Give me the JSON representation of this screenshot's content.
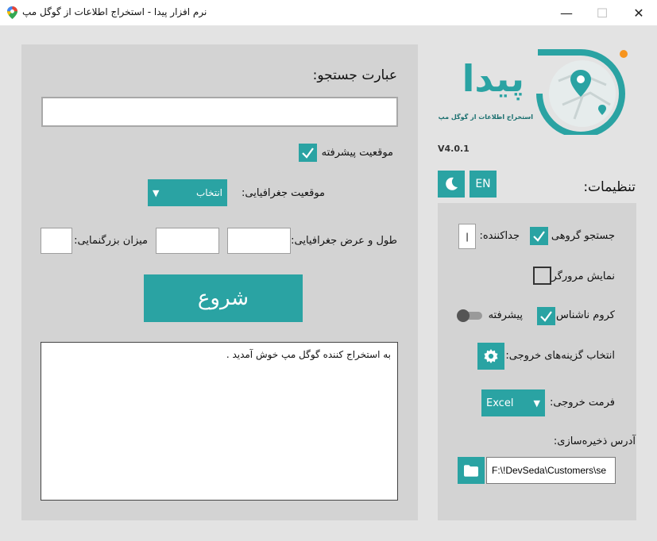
{
  "window": {
    "title": "نرم افزار پیدا - استخراج اطلاعات از گوگل مپ",
    "minimize_glyph": "—",
    "maximize_glyph": "☐",
    "close_glyph": "✕"
  },
  "search": {
    "label": "عبارت جستجو:",
    "value": "",
    "advanced_location_label": "موقعیت پیشرفته",
    "advanced_location_checked": true,
    "geo_location_label": "موقعیت جغرافیایی:",
    "geo_location_selected": "انتخاب",
    "latlng_label": "طول و عرض جغرافیایی:",
    "lat_value": "",
    "lng_value": "",
    "zoom_label": "میزان بزرگنمایی:",
    "zoom_value": "",
    "start_button": "شروع"
  },
  "log": {
    "lines": [
      "به استخراج کننده گوگل مپ خوش آمدید ."
    ]
  },
  "brand": {
    "name": "پیدا",
    "tagline": "استخراج اطلاعات از گوگل مپ",
    "version": "V4.0.1",
    "accent": "#2aa3a3",
    "orange": "#f7941d"
  },
  "settings": {
    "title": "تنظیمات:",
    "lang_button": "EN",
    "theme_icon": "moon-icon",
    "group_search_label": "جستجو گروهی",
    "group_search_checked": true,
    "separator_label": "جداکننده:",
    "separator_value": "|",
    "show_browser_label": "نمایش مرورگر",
    "show_browser_checked": false,
    "incognito_label": "کروم ناشناس",
    "incognito_checked": true,
    "advanced_label": "پیشرفته",
    "advanced_toggle_on": false,
    "output_options_label": "انتخاب گزینه‌های خروجی:",
    "output_format_label": "فرمت خروجی:",
    "output_format_value": "Excel",
    "save_path_label": "آدرس ذخیره‌سازی:",
    "save_path_value": "F:\\!DevSeda\\Customers\\se"
  }
}
